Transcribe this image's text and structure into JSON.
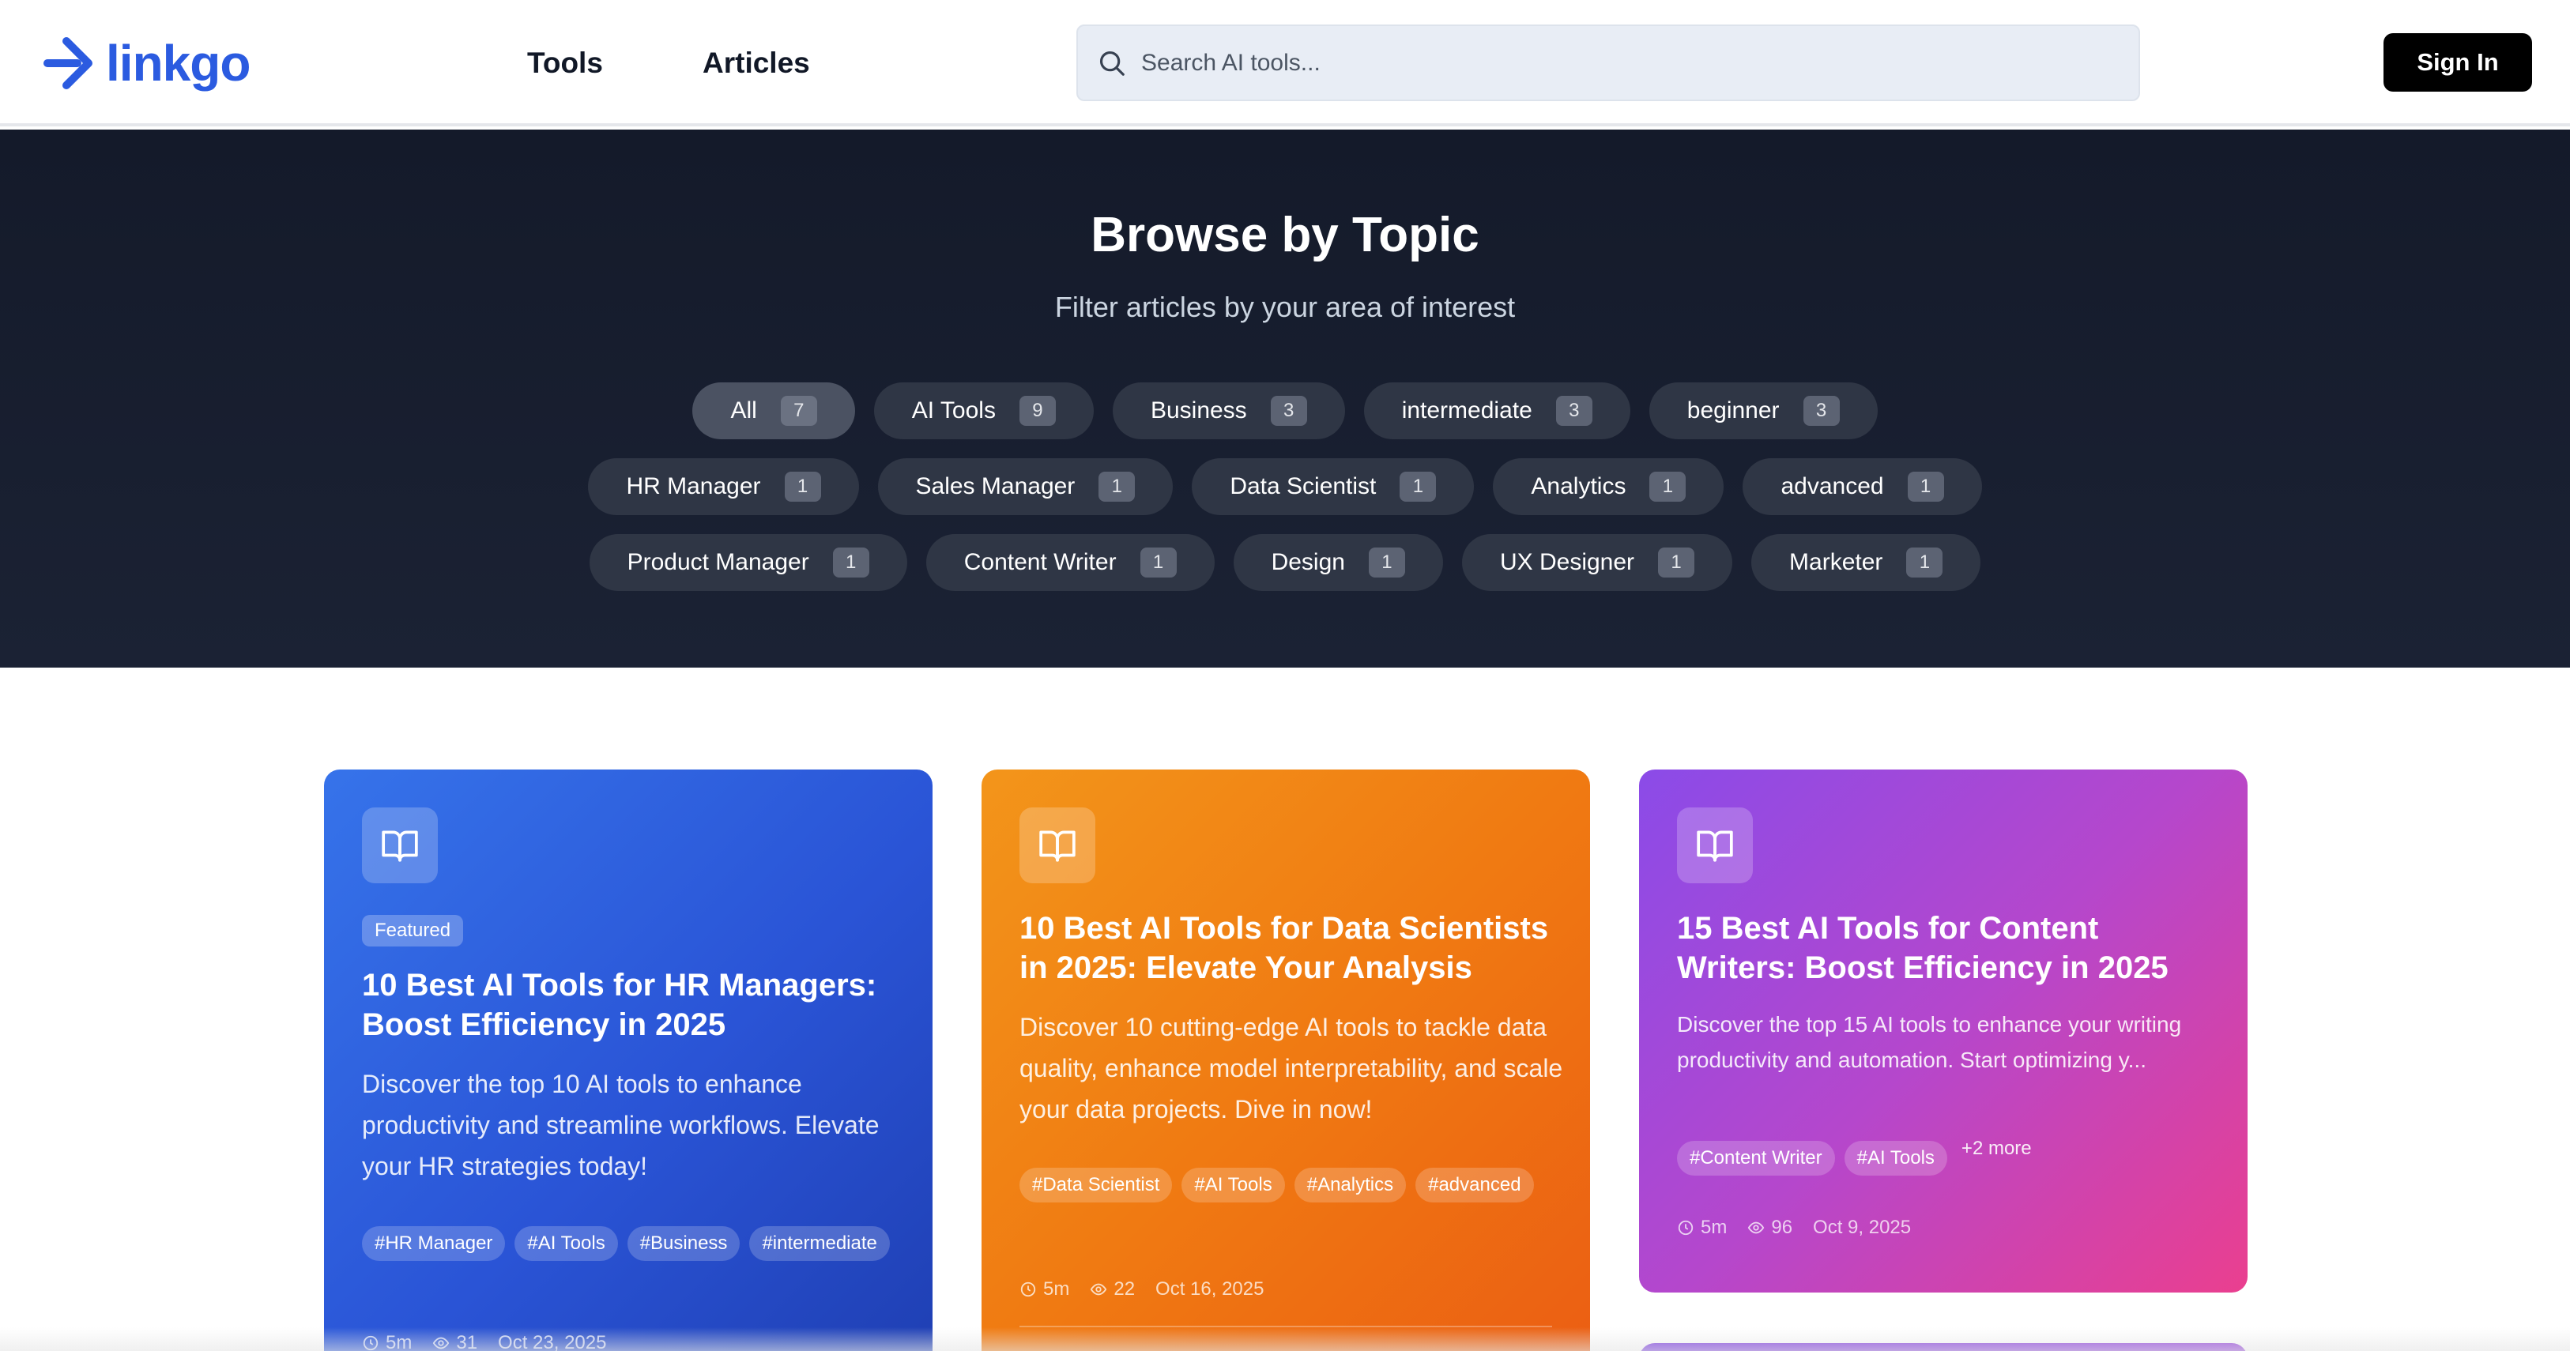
{
  "brand": {
    "name": "linkgo",
    "color": "#2b5be0"
  },
  "nav": {
    "tools": "Tools",
    "articles": "Articles"
  },
  "search": {
    "placeholder": "Search AI tools..."
  },
  "auth": {
    "sign_in": "Sign In"
  },
  "hero": {
    "title": "Browse by Topic",
    "subtitle": "Filter articles by your area of interest",
    "rows": [
      [
        {
          "label": "All",
          "count": "7",
          "active": true
        },
        {
          "label": "AI Tools",
          "count": "9"
        },
        {
          "label": "Business",
          "count": "3"
        },
        {
          "label": "intermediate",
          "count": "3"
        },
        {
          "label": "beginner",
          "count": "3"
        }
      ],
      [
        {
          "label": "HR Manager",
          "count": "1"
        },
        {
          "label": "Sales Manager",
          "count": "1"
        },
        {
          "label": "Data Scientist",
          "count": "1"
        },
        {
          "label": "Analytics",
          "count": "1"
        },
        {
          "label": "advanced",
          "count": "1"
        }
      ],
      [
        {
          "label": "Product Manager",
          "count": "1"
        },
        {
          "label": "Content Writer",
          "count": "1"
        },
        {
          "label": "Design",
          "count": "1"
        },
        {
          "label": "UX Designer",
          "count": "1"
        },
        {
          "label": "Marketer",
          "count": "1"
        }
      ]
    ]
  },
  "cards": [
    {
      "badge": "Featured",
      "title": "10 Best AI Tools for HR Managers: Boost Efficiency in 2025",
      "description": "Discover the top 10 AI tools to enhance productivity and streamline workflows. Elevate your HR strategies today!",
      "tags": [
        "#HR Manager",
        "#AI Tools",
        "#Business",
        "#intermediate"
      ],
      "read_time": "5m",
      "views": "31",
      "date": "Oct 23, 2025",
      "gradient": [
        "#3673ea",
        "#1f3fb3"
      ]
    },
    {
      "title": "10 Best AI Tools for Data Scientists in 2025: Elevate Your Analysis",
      "description": "Discover 10 cutting-edge AI tools to tackle data quality, enhance model interpretability, and scale your data projects. Dive in now!",
      "tags": [
        "#Data Scientist",
        "#AI Tools",
        "#Analytics",
        "#advanced"
      ],
      "read_time": "5m",
      "views": "22",
      "date": "Oct 16, 2025",
      "gradient": [
        "#f3951a",
        "#eb5e13"
      ]
    },
    {
      "title": "15 Best AI Tools for Content Writers: Boost Efficiency in 2025",
      "description": "Discover the top 15 AI tools to enhance your writing productivity and automation. Start optimizing y...",
      "tags": [
        "#Content Writer",
        "#AI Tools"
      ],
      "more": "+2 more",
      "read_time": "5m",
      "views": "96",
      "date": "Oct 9, 2025",
      "gradient": [
        "#8b4be8",
        "#ea3f8f"
      ]
    }
  ]
}
